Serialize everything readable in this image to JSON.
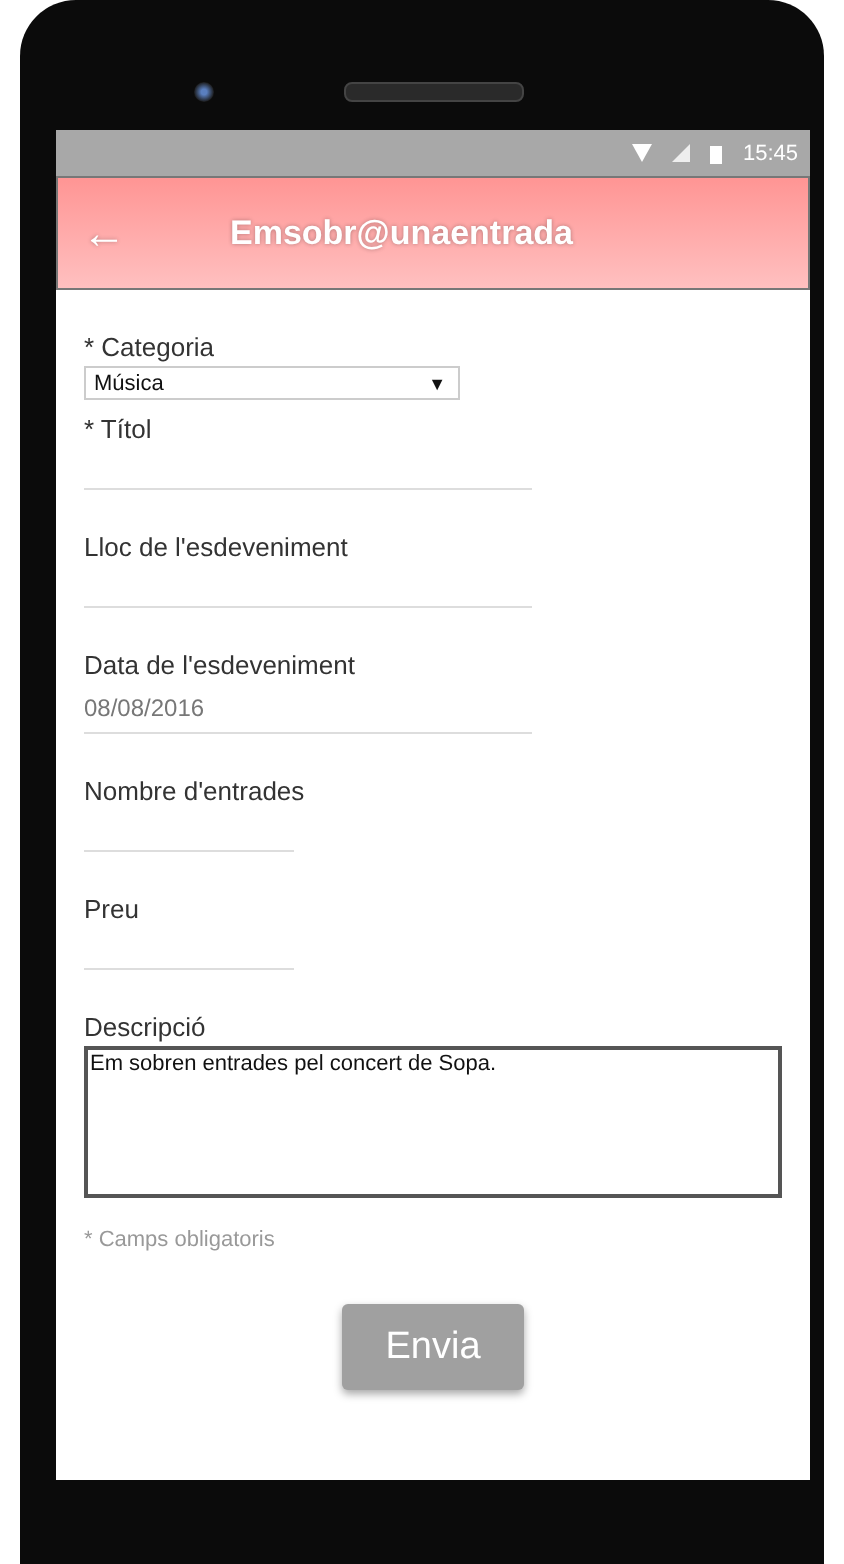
{
  "status_bar": {
    "time": "15:45"
  },
  "header": {
    "back": "←",
    "title": "Emsobr@unaentrada"
  },
  "fields": [
    {
      "kind": "select",
      "label": "* Categoria",
      "value": "Música",
      "arrow": "▼"
    },
    {
      "kind": "line",
      "label": "* Títol"
    },
    {
      "kind": "line",
      "label": "Lloc de l'esdeveniment"
    },
    {
      "kind": "line",
      "label": "Data de l'esdeveniment",
      "value": "08/08/2016"
    },
    {
      "kind": "short",
      "label": "Nombre d'entrades"
    },
    {
      "kind": "short",
      "label": "Preu"
    },
    {
      "kind": "textarea",
      "label": "Descripció",
      "value": "Em sobren entrades pel concert de Sopa."
    }
  ],
  "footnote": "* Camps obligatoris",
  "submit": "Envia"
}
